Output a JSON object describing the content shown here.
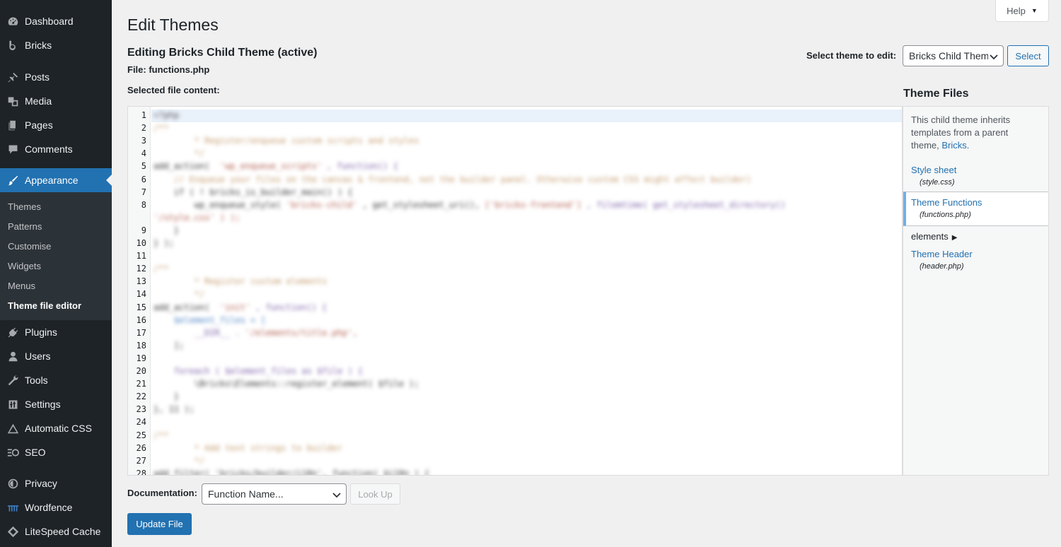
{
  "sidebar": {
    "menu": [
      {
        "label": "Dashboard",
        "icon": "dashboard-icon"
      },
      {
        "label": "Bricks",
        "icon": "bricks-logo-icon"
      },
      {
        "label": "Posts",
        "icon": "pushpin-icon"
      },
      {
        "label": "Media",
        "icon": "media-icon"
      },
      {
        "label": "Pages",
        "icon": "pages-icon"
      },
      {
        "label": "Comments",
        "icon": "comment-icon"
      },
      {
        "label": "Appearance",
        "icon": "paintbrush-icon"
      },
      {
        "label": "Plugins",
        "icon": "plugin-icon"
      },
      {
        "label": "Users",
        "icon": "users-icon"
      },
      {
        "label": "Tools",
        "icon": "wrench-icon"
      },
      {
        "label": "Settings",
        "icon": "settings-icon"
      },
      {
        "label": "Automatic CSS",
        "icon": "triangle-icon"
      },
      {
        "label": "SEO",
        "icon": "seo-icon"
      },
      {
        "label": "Privacy",
        "icon": "privacy-icon"
      },
      {
        "label": "Wordfence",
        "icon": "wordfence-icon"
      },
      {
        "label": "LiteSpeed Cache",
        "icon": "diamond-icon"
      }
    ],
    "submenu": [
      "Themes",
      "Patterns",
      "Customise",
      "Widgets",
      "Menus",
      "Theme file editor"
    ]
  },
  "header": {
    "title": "Edit Themes",
    "help": "Help"
  },
  "editing": {
    "title": "Editing Bricks Child Theme (active)",
    "file_line": "File: functions.php",
    "selected_label": "Selected file content:"
  },
  "theme_select": {
    "label": "Select theme to edit:",
    "value": "Bricks Child Theme",
    "button": "Select"
  },
  "editor": {
    "line_numbers": [
      "1",
      "2",
      "3",
      "4",
      "5",
      "6",
      "7",
      "8",
      "9",
      "10",
      "11",
      "12",
      "13",
      "14",
      "15",
      "16",
      "17",
      "18",
      "19",
      "20",
      "21",
      "22",
      "23",
      "24",
      "25",
      "26",
      "27",
      "28"
    ]
  },
  "theme_files": {
    "heading": "Theme Files",
    "description": "This child theme inherits templates from a parent theme,",
    "parent_link": "Bricks.",
    "stylesheet": {
      "label": "Style sheet",
      "file": "(style.css)"
    },
    "functions": {
      "label": "Theme Functions",
      "file": "(functions.php)"
    },
    "elements": "elements",
    "header": {
      "label": "Theme Header",
      "file": "(header.php)"
    }
  },
  "documentation": {
    "label": "Documentation:",
    "placeholder": "Function Name...",
    "lookup": "Look Up"
  },
  "update_button": "Update File",
  "colors": {
    "sidebar_bg": "#1d2327",
    "accent": "#2271b1",
    "page_bg": "#f0f0f1"
  }
}
